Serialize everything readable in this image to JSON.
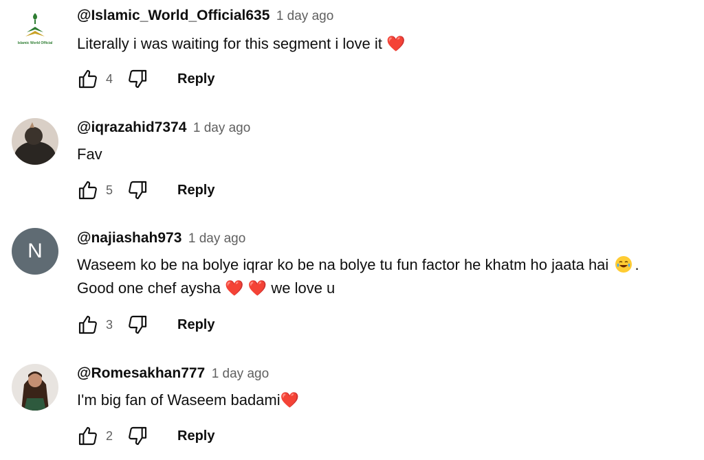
{
  "comments": [
    {
      "author": "@Islamic_World_Official635",
      "time": "1 day ago",
      "text": "Literally i was waiting for this segment i love it",
      "likes": "4",
      "reply": "Reply",
      "avatar_label": "Islamic World Official",
      "avatar": "islamic-logo"
    },
    {
      "author": "@iqrazahid7374",
      "time": "1 day ago",
      "text": "Fav",
      "likes": "5",
      "reply": "Reply",
      "avatar": "photo-dark"
    },
    {
      "author": "@najiashah973",
      "time": "1 day ago",
      "text_line1_a": "Waseem ko be na bolye iqrar ko be na bolye tu fun factor he khatm ho jaata hai",
      "text_line1_b": ".",
      "text_line2_a": "Good one chef aysha",
      "text_line2_b": "we love u",
      "likes": "3",
      "reply": "Reply",
      "avatar_initial": "N",
      "avatar_color": "#5f6b73"
    },
    {
      "author": "@Romesakhan777",
      "time": "1 day ago",
      "text": "I'm big fan of Waseem badami",
      "likes": "2",
      "reply": "Reply",
      "avatar": "photo-girl"
    }
  ],
  "icons": {
    "like": "thumb-up-icon",
    "dislike": "thumb-down-icon",
    "heart": "red-heart-emoji",
    "laugh": "tears-of-joy-emoji"
  },
  "colors": {
    "text": "#0f0f0f",
    "secondary": "#606060",
    "heart": "#e0303b"
  }
}
